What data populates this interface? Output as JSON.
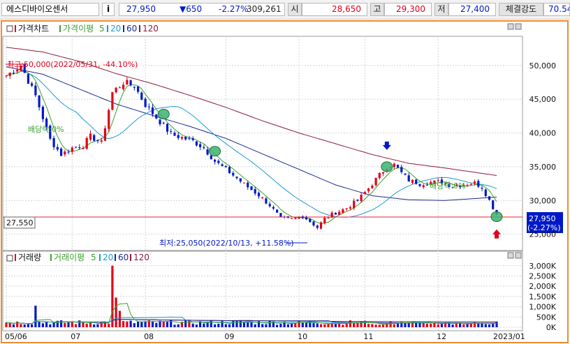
{
  "topbar": {
    "stock_name": "에스디바이오센서",
    "info_icon": "i",
    "price": "27,950",
    "change": "▼650",
    "change_pct": "-2.27%",
    "volume": "309,261",
    "open_label": "시",
    "open": "28,650",
    "high_label": "고",
    "high": "29,300",
    "low_label": "저",
    "low": "27,400",
    "strength_label": "체결강도",
    "strength": "70.54"
  },
  "colors": {
    "up": "#e1001a",
    "down": "#0019c8",
    "ma5": "#3aa12b",
    "ma20": "#1a9ad6",
    "ma60": "#1b2b8f",
    "ma120": "#8c1d3a",
    "frame": "#f08c30",
    "current_line": "#e8253a",
    "marker": "#3cb371"
  },
  "chart_data": [
    {
      "type": "candlestick",
      "title": "가격차트",
      "legend": [
        {
          "name": "가격이평",
          "period": "5",
          "color": "ma5"
        },
        {
          "name": "",
          "period": "20",
          "color": "ma20"
        },
        {
          "name": "",
          "period": "60",
          "color": "ma60"
        },
        {
          "name": "",
          "period": "120",
          "color": "ma120"
        }
      ],
      "ylim": [
        23000,
        53500
      ],
      "yticks": [
        25000,
        30000,
        35000,
        40000,
        45000,
        50000
      ],
      "ytick_labels": [
        "25,000",
        "30,000",
        "35,000",
        "40,000",
        "45,000",
        "50,000"
      ],
      "close_path": [
        [
          0,
          48500
        ],
        [
          4,
          50000
        ],
        [
          8,
          45500
        ],
        [
          12,
          39000
        ],
        [
          15,
          36800
        ],
        [
          18,
          37800
        ],
        [
          21,
          38200
        ],
        [
          23,
          39500
        ],
        [
          26,
          38500
        ],
        [
          29,
          46000
        ],
        [
          32,
          47500
        ],
        [
          35,
          47000
        ],
        [
          38,
          44200
        ],
        [
          41,
          42300
        ],
        [
          45,
          39800
        ],
        [
          48,
          39300
        ],
        [
          51,
          38800
        ],
        [
          54,
          37800
        ],
        [
          57,
          35800
        ],
        [
          60,
          34600
        ],
        [
          63,
          33300
        ],
        [
          66,
          32000
        ],
        [
          69,
          30800
        ],
        [
          72,
          29300
        ],
        [
          75,
          27300
        ],
        [
          78,
          27200
        ],
        [
          81,
          27700
        ],
        [
          83,
          26900
        ],
        [
          85,
          26000
        ],
        [
          87,
          27300
        ],
        [
          90,
          28200
        ],
        [
          93,
          28900
        ],
        [
          96,
          30000
        ],
        [
          99,
          31800
        ],
        [
          102,
          33800
        ],
        [
          104,
          35000
        ],
        [
          106,
          35300
        ],
        [
          108,
          34100
        ],
        [
          110,
          33000
        ],
        [
          113,
          32500
        ],
        [
          116,
          32700
        ],
        [
          119,
          32800
        ],
        [
          122,
          32100
        ],
        [
          125,
          32400
        ],
        [
          128,
          32600
        ],
        [
          130,
          32000
        ],
        [
          132,
          30000
        ],
        [
          134,
          27950
        ]
      ],
      "ma120_path": [
        [
          0,
          52700
        ],
        [
          10,
          52000
        ],
        [
          20,
          50600
        ],
        [
          30,
          48800
        ],
        [
          40,
          47300
        ],
        [
          50,
          45600
        ],
        [
          60,
          43800
        ],
        [
          70,
          41800
        ],
        [
          80,
          40000
        ],
        [
          90,
          38400
        ],
        [
          100,
          36800
        ],
        [
          110,
          35500
        ],
        [
          120,
          34800
        ],
        [
          134,
          33700
        ]
      ],
      "ma60_path": [
        [
          0,
          49800
        ],
        [
          10,
          48700
        ],
        [
          20,
          46500
        ],
        [
          30,
          44300
        ],
        [
          40,
          42600
        ],
        [
          50,
          41000
        ],
        [
          60,
          39200
        ],
        [
          70,
          36900
        ],
        [
          80,
          34600
        ],
        [
          90,
          32300
        ],
        [
          100,
          30700
        ],
        [
          110,
          30100
        ],
        [
          120,
          30000
        ],
        [
          134,
          30500
        ]
      ],
      "current_price_label": "27,550",
      "current_price_value": 27550,
      "last_price_label": "27,950",
      "last_change_label": "(-2.27%)",
      "last_price_value": 27950,
      "annotations": {
        "high": "최고:50,000(2022/05/31, -44.10%)",
        "low": "최저:25,050(2022/10/13, +11.58%)",
        "dividend_1": "배당락:0%",
        "dividend_2": "배당락:0%"
      },
      "circle_markers": [
        {
          "i": 43,
          "value": 42800
        },
        {
          "i": 57,
          "value": 37300
        },
        {
          "i": 104,
          "value": 35000
        },
        {
          "i": 134,
          "value": 27600
        }
      ],
      "arrows": [
        {
          "i": 104,
          "dir": "down",
          "color": "down",
          "value": 37800
        },
        {
          "i": 134,
          "dir": "up",
          "color": "up",
          "value": 25200
        }
      ]
    },
    {
      "type": "bar",
      "title": "거래량",
      "legend": [
        {
          "name": "거래이평",
          "period": "5",
          "color": "ma5"
        },
        {
          "name": "",
          "period": "20",
          "color": "ma20"
        },
        {
          "name": "",
          "period": "60",
          "color": "ma60"
        },
        {
          "name": "",
          "period": "120",
          "color": "ma120"
        }
      ],
      "ylim": [
        -500000,
        3400000
      ],
      "yticks": [
        0,
        500000,
        1000000,
        1500000,
        2000000,
        2500000,
        3000000
      ],
      "ytick_labels": [
        "0K",
        "500K",
        "1,000K",
        "1,500K",
        "2,000K",
        "2,500K",
        "3,000K"
      ],
      "spikes": [
        {
          "i": 8,
          "value": 1050000
        },
        {
          "i": 29,
          "value": 3000000
        },
        {
          "i": 30,
          "value": 1450000
        },
        {
          "i": 31,
          "value": 800000
        }
      ]
    }
  ],
  "x_axis": {
    "labels": [
      {
        "i": 0,
        "text": "05/06"
      },
      {
        "i": 18,
        "text": "07"
      },
      {
        "i": 38,
        "text": "08"
      },
      {
        "i": 60,
        "text": "09"
      },
      {
        "i": 80,
        "text": "10"
      },
      {
        "i": 98,
        "text": "11"
      },
      {
        "i": 118,
        "text": "12"
      },
      {
        "i": 136,
        "text": "2023/01"
      }
    ]
  }
}
